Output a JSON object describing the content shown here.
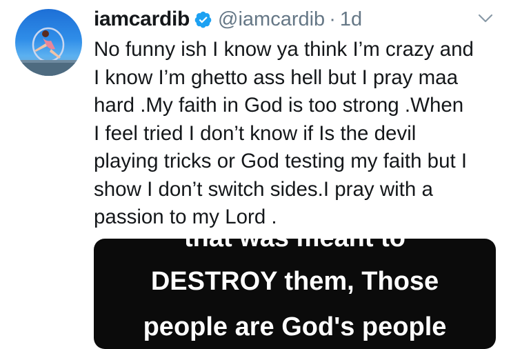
{
  "tweet": {
    "display_name": "iamcardib",
    "handle": "@iamcardib",
    "separator": "·",
    "time": "1d",
    "text": "No funny ish I know ya think I’m crazy and\nI know I’m ghetto ass hell but I pray maa\nhard .My faith in God is too strong .When\nI feel tried I don’t know if Is the devil\nplaying tricks or God testing my faith but I\nshow I don’t switch sides.I pray with a\npassion to my Lord .",
    "media_text": [
      "that was meant to",
      "DESTROY them, Those",
      "people are God's people"
    ]
  },
  "icons": {
    "verified": "verified-badge-icon",
    "caret": "chevron-down-icon"
  },
  "colors": {
    "verified": "#1da1f2",
    "secondary_text": "#657786",
    "primary_text": "#14171a",
    "media_bg": "#0b0b0b"
  }
}
